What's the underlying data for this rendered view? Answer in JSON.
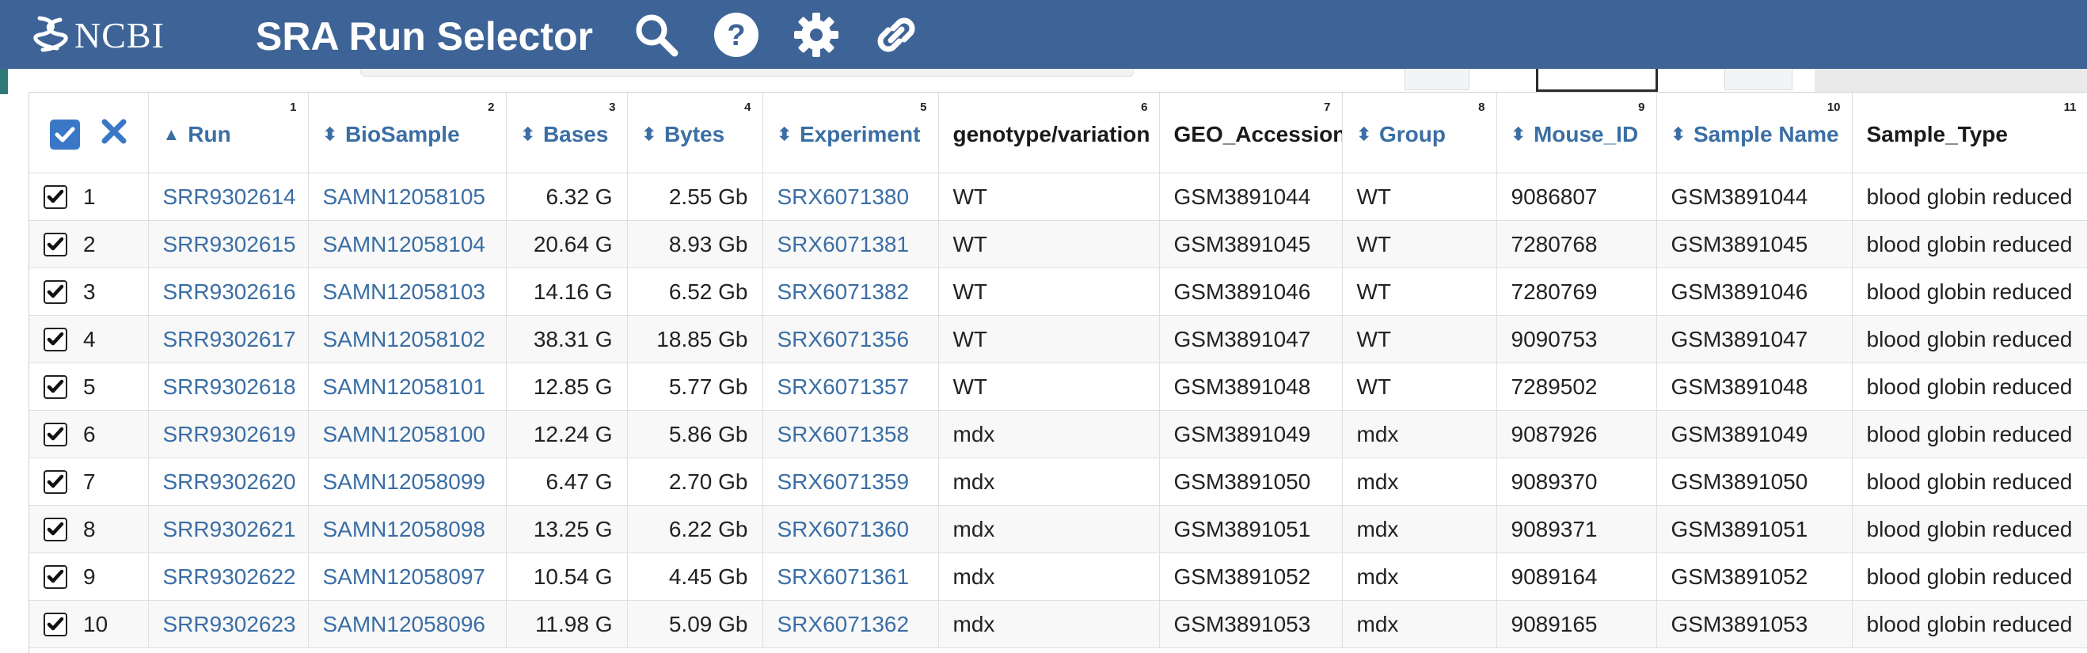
{
  "header": {
    "logo_text": "NCBI",
    "title": "SRA Run Selector",
    "icons": [
      "search-icon",
      "help-icon",
      "gear-icon",
      "link-icon"
    ]
  },
  "colors": {
    "header_bg": "#3e6497",
    "link": "#3a6ea5",
    "checkbox_accent": "#3a78c7"
  },
  "table": {
    "columns": [
      {
        "label": "Run",
        "num": "1"
      },
      {
        "label": "BioSample",
        "num": "2"
      },
      {
        "label": "Bases",
        "num": "3"
      },
      {
        "label": "Bytes",
        "num": "4"
      },
      {
        "label": "Experiment",
        "num": "5"
      },
      {
        "label": "genotype/variation",
        "num": "6"
      },
      {
        "label": "GEO_Accession",
        "num": "7"
      },
      {
        "label": "Group",
        "num": "8"
      },
      {
        "label": "Mouse_ID",
        "num": "9"
      },
      {
        "label": "Sample Name",
        "num": "10"
      },
      {
        "label": "Sample_Type",
        "num": "11"
      }
    ],
    "rows": [
      {
        "n": "1",
        "run": "SRR9302614",
        "biosample": "SAMN12058105",
        "bases": "6.32 G",
        "bytes": "2.55 Gb",
        "experiment": "SRX6071380",
        "genotype": "WT",
        "geo": "GSM3891044",
        "group": "WT",
        "mouse_id": "9086807",
        "sample_name": "GSM3891044",
        "sample_type": "blood globin reduced"
      },
      {
        "n": "2",
        "run": "SRR9302615",
        "biosample": "SAMN12058104",
        "bases": "20.64 G",
        "bytes": "8.93 Gb",
        "experiment": "SRX6071381",
        "genotype": "WT",
        "geo": "GSM3891045",
        "group": "WT",
        "mouse_id": "7280768",
        "sample_name": "GSM3891045",
        "sample_type": "blood globin reduced"
      },
      {
        "n": "3",
        "run": "SRR9302616",
        "biosample": "SAMN12058103",
        "bases": "14.16 G",
        "bytes": "6.52 Gb",
        "experiment": "SRX6071382",
        "genotype": "WT",
        "geo": "GSM3891046",
        "group": "WT",
        "mouse_id": "7280769",
        "sample_name": "GSM3891046",
        "sample_type": "blood globin reduced"
      },
      {
        "n": "4",
        "run": "SRR9302617",
        "biosample": "SAMN12058102",
        "bases": "38.31 G",
        "bytes": "18.85 Gb",
        "experiment": "SRX6071356",
        "genotype": "WT",
        "geo": "GSM3891047",
        "group": "WT",
        "mouse_id": "9090753",
        "sample_name": "GSM3891047",
        "sample_type": "blood globin reduced"
      },
      {
        "n": "5",
        "run": "SRR9302618",
        "biosample": "SAMN12058101",
        "bases": "12.85 G",
        "bytes": "5.77 Gb",
        "experiment": "SRX6071357",
        "genotype": "WT",
        "geo": "GSM3891048",
        "group": "WT",
        "mouse_id": "7289502",
        "sample_name": "GSM3891048",
        "sample_type": "blood globin reduced"
      },
      {
        "n": "6",
        "run": "SRR9302619",
        "biosample": "SAMN12058100",
        "bases": "12.24 G",
        "bytes": "5.86 Gb",
        "experiment": "SRX6071358",
        "genotype": "mdx",
        "geo": "GSM3891049",
        "group": "mdx",
        "mouse_id": "9087926",
        "sample_name": "GSM3891049",
        "sample_type": "blood globin reduced"
      },
      {
        "n": "7",
        "run": "SRR9302620",
        "biosample": "SAMN12058099",
        "bases": "6.47 G",
        "bytes": "2.70 Gb",
        "experiment": "SRX6071359",
        "genotype": "mdx",
        "geo": "GSM3891050",
        "group": "mdx",
        "mouse_id": "9089370",
        "sample_name": "GSM3891050",
        "sample_type": "blood globin reduced"
      },
      {
        "n": "8",
        "run": "SRR9302621",
        "biosample": "SAMN12058098",
        "bases": "13.25 G",
        "bytes": "6.22 Gb",
        "experiment": "SRX6071360",
        "genotype": "mdx",
        "geo": "GSM3891051",
        "group": "mdx",
        "mouse_id": "9089371",
        "sample_name": "GSM3891051",
        "sample_type": "blood globin reduced"
      },
      {
        "n": "9",
        "run": "SRR9302622",
        "biosample": "SAMN12058097",
        "bases": "10.54 G",
        "bytes": "4.45 Gb",
        "experiment": "SRX6071361",
        "genotype": "mdx",
        "geo": "GSM3891052",
        "group": "mdx",
        "mouse_id": "9089164",
        "sample_name": "GSM3891052",
        "sample_type": "blood globin reduced"
      },
      {
        "n": "10",
        "run": "SRR9302623",
        "biosample": "SAMN12058096",
        "bases": "11.98 G",
        "bytes": "5.09 Gb",
        "experiment": "SRX6071362",
        "genotype": "mdx",
        "geo": "GSM3891053",
        "group": "mdx",
        "mouse_id": "9089165",
        "sample_name": "GSM3891053",
        "sample_type": "blood globin reduced"
      }
    ]
  }
}
